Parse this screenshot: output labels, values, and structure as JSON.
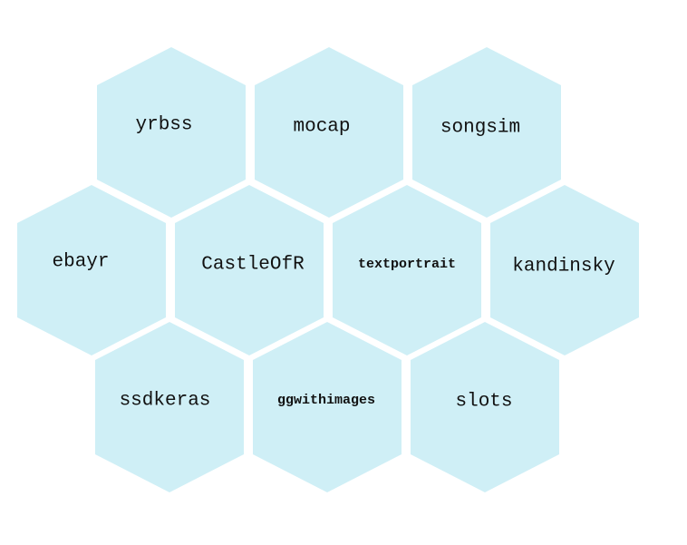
{
  "colors": {
    "hex_fill": "#cfeff6",
    "text": "#111111",
    "background": "#ffffff"
  },
  "hexes": [
    {
      "label": "yrbss",
      "row": 0,
      "col": 0
    },
    {
      "label": "mocap",
      "row": 0,
      "col": 1
    },
    {
      "label": "songsim",
      "row": 0,
      "col": 2
    },
    {
      "label": "ebayr",
      "row": 1,
      "col": 0
    },
    {
      "label": "CastleOfR",
      "row": 1,
      "col": 1
    },
    {
      "label": "textportrait",
      "row": 1,
      "col": 2
    },
    {
      "label": "kandinsky",
      "row": 1,
      "col": 3
    },
    {
      "label": "ssdkeras",
      "row": 2,
      "col": 0
    },
    {
      "label": "ggwithimages",
      "row": 2,
      "col": 1
    },
    {
      "label": "slots",
      "row": 2,
      "col": 2
    }
  ]
}
